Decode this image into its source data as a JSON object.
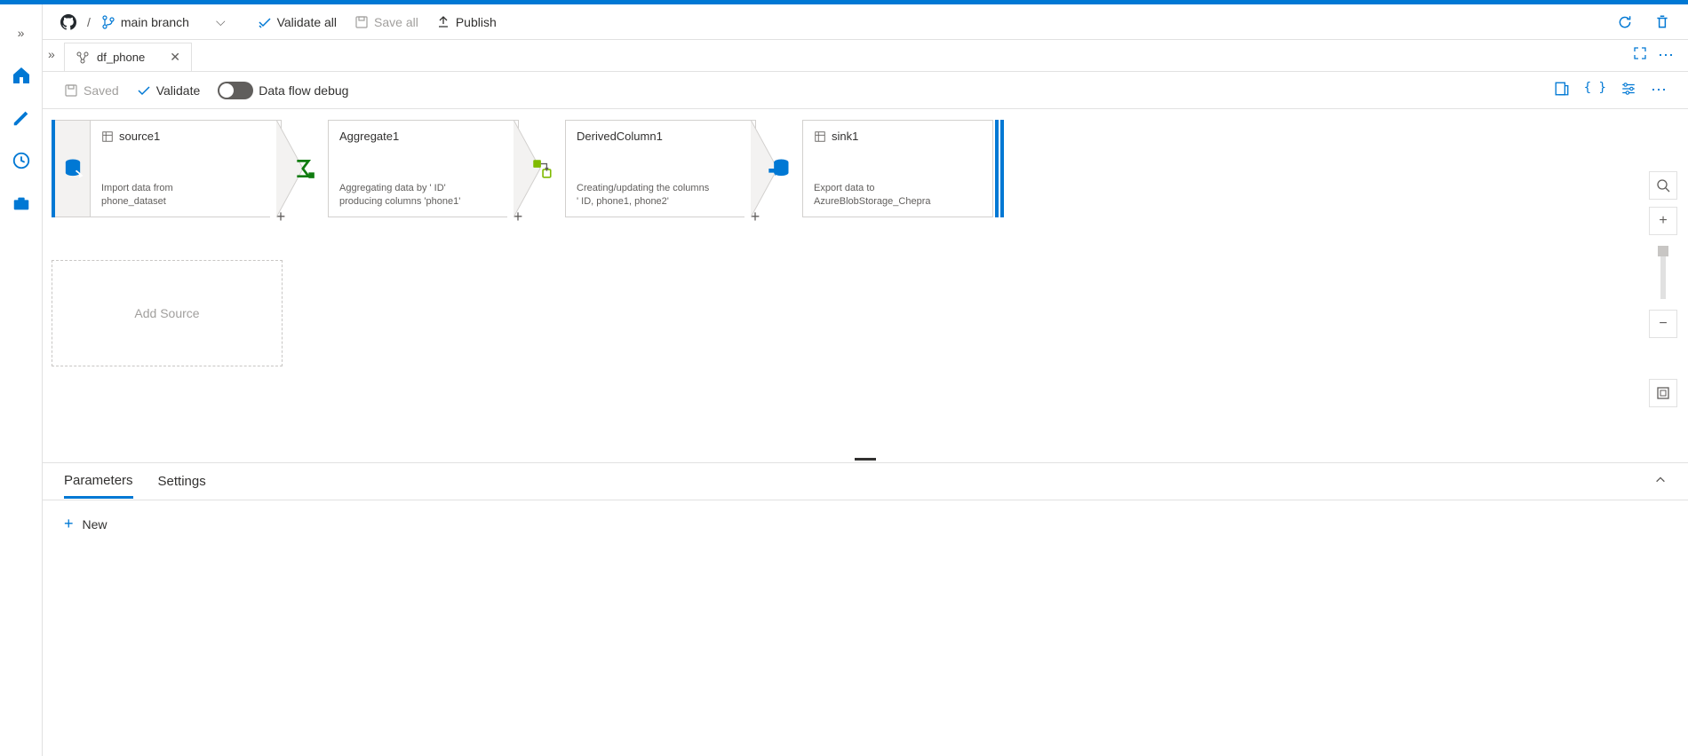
{
  "toolbar": {
    "breadcrumb_sep": "/",
    "branch": "main branch",
    "validate_all": "Validate all",
    "save_all": "Save all",
    "publish": "Publish"
  },
  "tab": {
    "name": "df_phone"
  },
  "actionbar": {
    "saved": "Saved",
    "validate": "Validate",
    "debug": "Data flow debug"
  },
  "flow": {
    "source": {
      "title": "source1",
      "desc_l1": "Import data from",
      "desc_l2": "phone_dataset"
    },
    "aggregate": {
      "title": "Aggregate1",
      "desc_l1": "Aggregating data by ' ID'",
      "desc_l2": "producing columns 'phone1'"
    },
    "derived": {
      "title": "DerivedColumn1",
      "desc_l1": "Creating/updating the columns",
      "desc_l2": "' ID, phone1, phone2'"
    },
    "sink": {
      "title": "sink1",
      "desc_l1": "Export data to",
      "desc_l2": "AzureBlobStorage_Chepra"
    },
    "add_source": "Add Source"
  },
  "bottom": {
    "tab_parameters": "Parameters",
    "tab_settings": "Settings",
    "new": "New"
  }
}
